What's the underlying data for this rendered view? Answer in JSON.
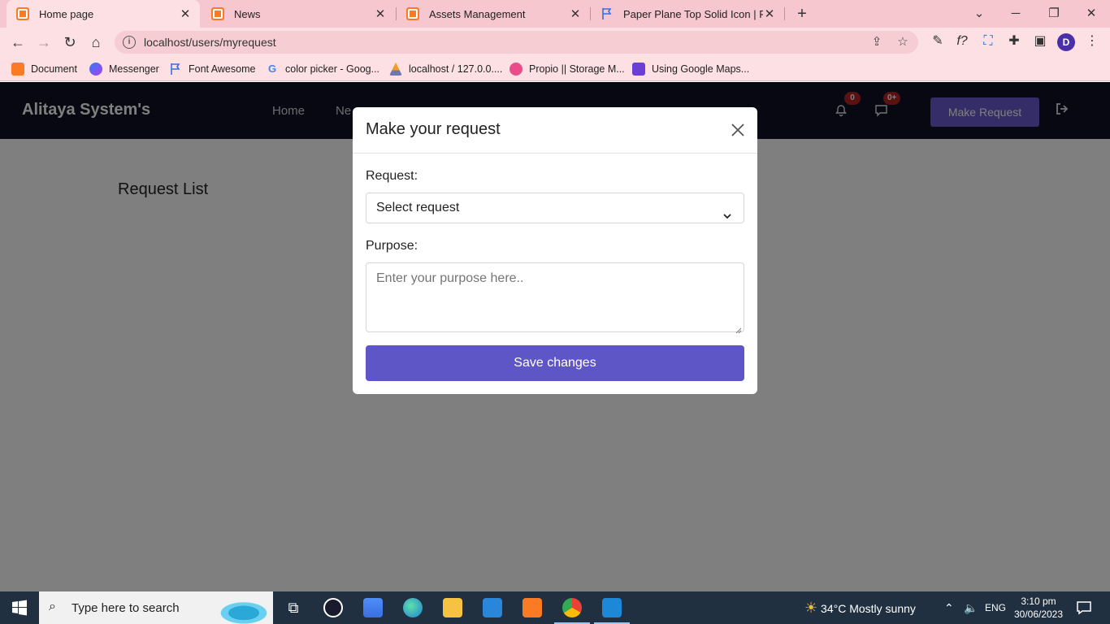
{
  "browser": {
    "tabs": [
      {
        "title": "Home page",
        "active": true
      },
      {
        "title": "News",
        "active": false
      },
      {
        "title": "Assets Management",
        "active": false
      },
      {
        "title": "Paper Plane Top Solid Icon | Font",
        "active": false
      }
    ],
    "new_tab_icon": "plus-icon",
    "url": "localhost/users/myrequest",
    "profile_initial": "D",
    "bookmarks": [
      {
        "label": "Document",
        "icon": "xampp-icon"
      },
      {
        "label": "Messenger",
        "icon": "messenger-icon"
      },
      {
        "label": "Font Awesome",
        "icon": "flag-icon"
      },
      {
        "label": "color picker - Goog...",
        "icon": "google-icon"
      },
      {
        "label": "localhost / 127.0.0....",
        "icon": "phpmyadmin-icon"
      },
      {
        "label": "Propio || Storage M...",
        "icon": "dribbble-icon"
      },
      {
        "label": "Using Google Maps...",
        "icon": "maps-icon"
      }
    ]
  },
  "app": {
    "brand": "Alitaya System's",
    "nav": {
      "home": "Home",
      "news_partial": "Ne"
    },
    "notifications_count": "0",
    "messages_count": "0+",
    "make_request_label": "Make Request",
    "content_title": "Request List"
  },
  "modal": {
    "title": "Make your request",
    "request_label": "Request:",
    "request_select_value": "Select request",
    "purpose_label": "Purpose:",
    "purpose_placeholder": "Enter your purpose here..",
    "save_label": "Save changes"
  },
  "taskbar": {
    "search_placeholder": "Type here to search",
    "weather": "34°C  Mostly sunny",
    "language": "ENG",
    "time": "3:10 pm",
    "date": "30/06/2023"
  },
  "colors": {
    "tabstrip": "#f6c7ce",
    "toolbar": "#fde0e4",
    "app_nav": "#0f1022",
    "accent": "#5e56c6",
    "badge": "#b22222"
  }
}
